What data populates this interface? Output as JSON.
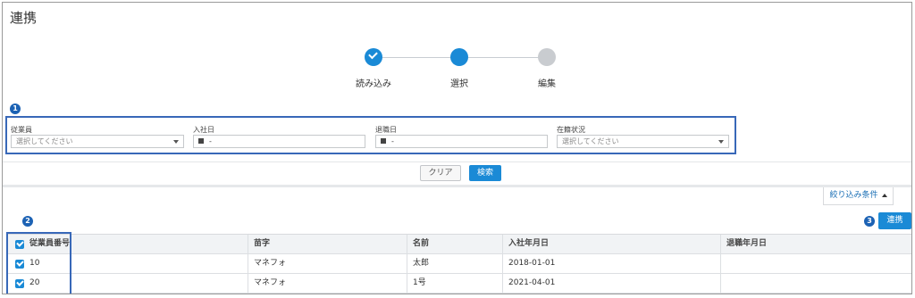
{
  "page": {
    "title": "連携"
  },
  "stepper": {
    "steps": [
      {
        "label": "読み込み",
        "state": "done"
      },
      {
        "label": "選択",
        "state": "current"
      },
      {
        "label": "編集",
        "state": "todo"
      }
    ]
  },
  "annotations": {
    "one": "1",
    "two": "2",
    "three": "3"
  },
  "filters": {
    "employee": {
      "label": "従業員",
      "placeholder": "選択してください"
    },
    "hire_date": {
      "label": "入社日",
      "value": "-"
    },
    "retire_date": {
      "label": "退職日",
      "value": "-"
    },
    "status": {
      "label": "在籍状況",
      "placeholder": "選択してください"
    }
  },
  "actions": {
    "clear": "クリア",
    "search": "検索",
    "filter_conditions": "絞り込み条件",
    "link": "連携"
  },
  "table": {
    "headers": [
      "従業員番号",
      "苗字",
      "名前",
      "入社年月日",
      "退職年月日"
    ],
    "rows": [
      [
        "10",
        "マネフォ",
        "太郎",
        "2018-01-01",
        ""
      ],
      [
        "20",
        "マネフォ",
        "1号",
        "2021-04-01",
        ""
      ]
    ]
  },
  "colors": {
    "accent": "#1a8ad6",
    "highlight_border": "#3868b8",
    "badge": "#1c62b4"
  }
}
